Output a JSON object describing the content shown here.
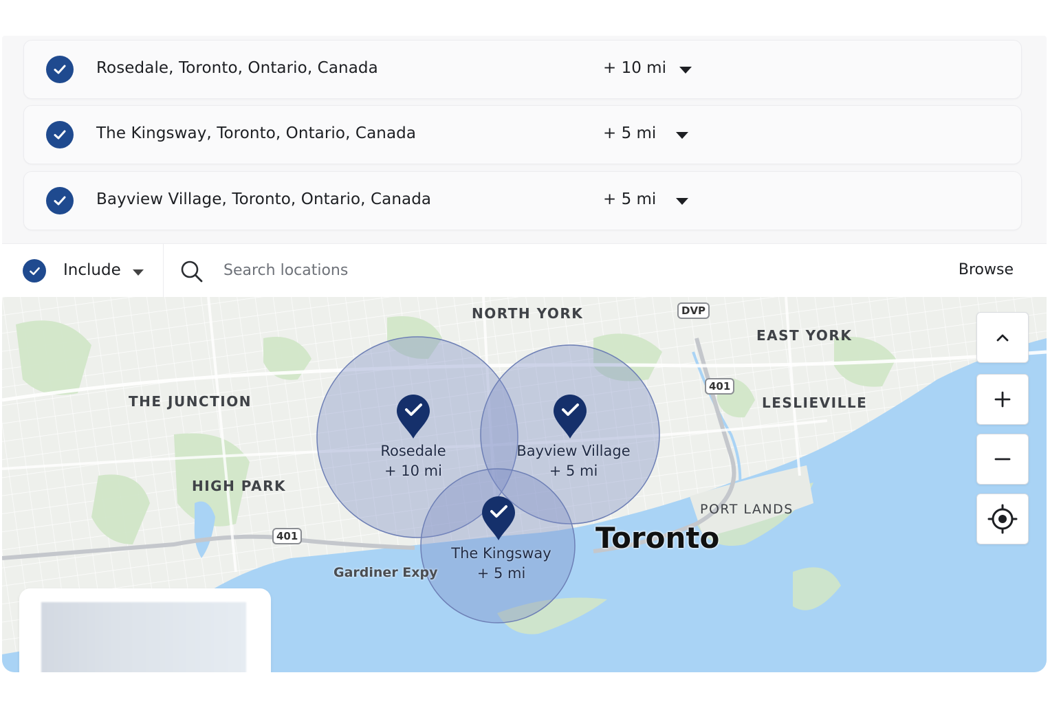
{
  "colors": {
    "accent": "#1f4a8f",
    "radius_fill": "#7d8fc4",
    "pin": "#15306b",
    "water": "#a9d3f5",
    "land": "#eef0ec",
    "park": "#cfe5c6"
  },
  "locations": [
    {
      "name": "Rosedale, Toronto, Ontario, Canada",
      "radius": "+ 10 mi",
      "checked": true
    },
    {
      "name": "The Kingsway, Toronto, Ontario, Canada",
      "radius": "+ 5 mi",
      "checked": true
    },
    {
      "name": "Bayview Village, Toronto, Ontario, Canada",
      "radius": "+ 5 mi",
      "checked": true
    }
  ],
  "filter": {
    "mode": "Include",
    "search_placeholder": "Search locations",
    "browse_label": "Browse"
  },
  "map": {
    "neighborhoods": {
      "north_york": "NORTH YORK",
      "east_york": "EAST YORK",
      "the_junction": "THE JUNCTION",
      "leslieville": "LESLIEVILLE",
      "high_park": "HIGH PARK",
      "port_lands": "PORT LANDS"
    },
    "city": "Toronto",
    "roads": {
      "gardiner": "Gardiner Expy",
      "dvp": "DVP",
      "hwy_401_east": "401",
      "hwy_401_west": "401"
    },
    "zones": [
      {
        "name": "Rosedale",
        "radius": "+ 10 mi"
      },
      {
        "name": "Bayview Village",
        "radius": "+ 5 mi"
      },
      {
        "name": "The Kingsway",
        "radius": "+ 5 mi"
      }
    ],
    "controls": {
      "collapse_icon": "chevron-up-icon",
      "zoom_in_icon": "plus-icon",
      "zoom_out_icon": "minus-icon",
      "locate_icon": "crosshair-icon"
    }
  }
}
